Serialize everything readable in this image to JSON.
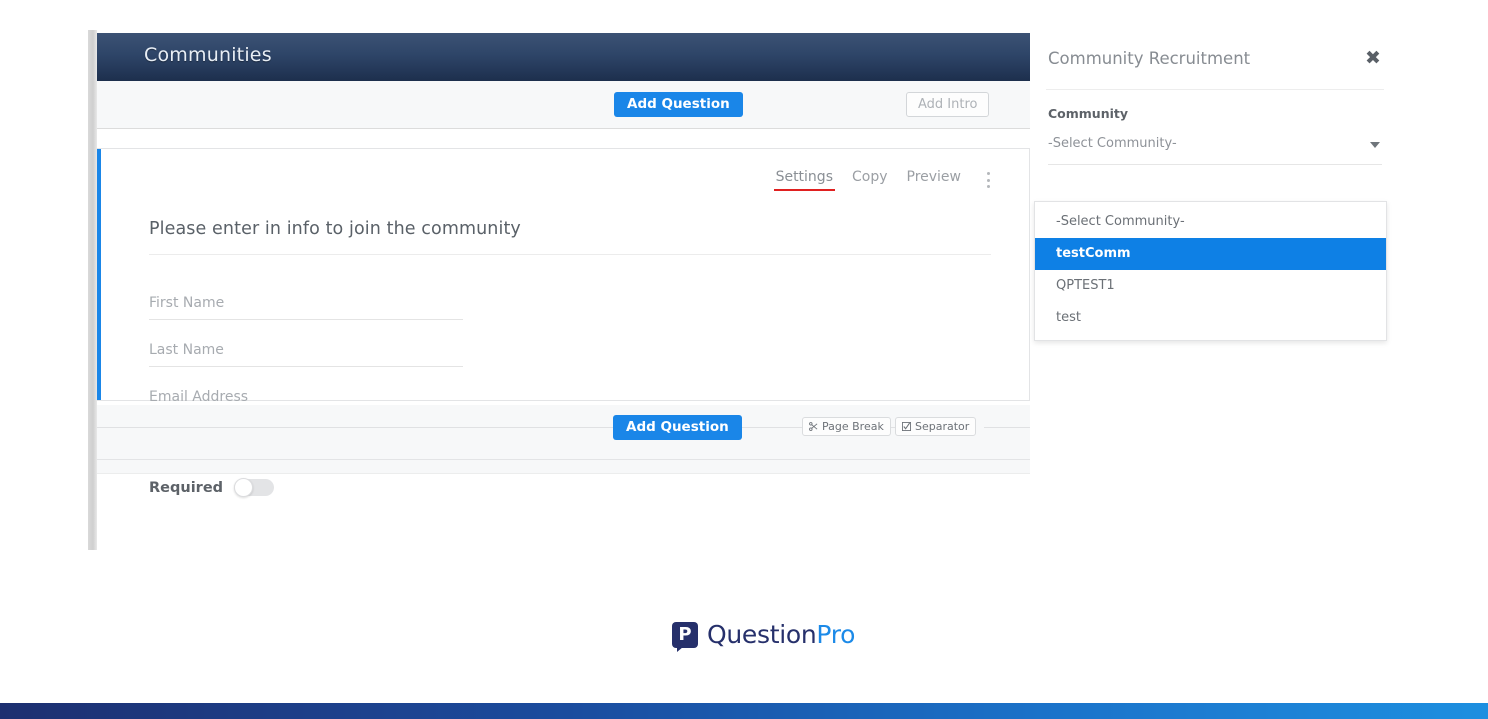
{
  "app": {
    "header_title": "Communities"
  },
  "top_toolbar": {
    "add_question_label": "Add Question",
    "add_intro_label": "Add Intro"
  },
  "question_card": {
    "actions": [
      {
        "label": "Settings",
        "active": true
      },
      {
        "label": "Copy",
        "active": false
      },
      {
        "label": "Preview",
        "active": false
      }
    ],
    "kebab_icon": "more-vertical-icon",
    "question_title": "Please enter in info to join the community",
    "fields": [
      {
        "placeholder": "First Name"
      },
      {
        "placeholder": "Last Name"
      },
      {
        "placeholder": "Email Address"
      }
    ],
    "required_label": "Required",
    "required_value": "off"
  },
  "bottom_toolbar": {
    "add_question_label": "Add Question",
    "page_break_label": "Page Break",
    "page_break_icon": "page-break-icon",
    "separator_label": "Separator",
    "separator_icon": "separator-checkbox-icon"
  },
  "side_panel": {
    "title": "Community Recruitment",
    "close_icon": "close-icon",
    "field_label": "Community",
    "select_value": "-Select Community-",
    "caret_icon": "chevron-down-icon",
    "options": [
      {
        "label": "-Select Community-",
        "selected": false
      },
      {
        "label": "testComm",
        "selected": true
      },
      {
        "label": "QPTEST1",
        "selected": false
      },
      {
        "label": "test",
        "selected": false
      }
    ]
  },
  "logo": {
    "mark_letter": "P",
    "text_part1": "Question",
    "text_part2": "Pro"
  },
  "colors": {
    "accent_blue": "#1a86e8",
    "header_navy": "#1d2f4d",
    "active_underline_red": "#e02020",
    "dropdown_selected_blue": "#0e80e5",
    "logo_navy": "#26306b",
    "logo_blue": "#1c8ae8"
  }
}
